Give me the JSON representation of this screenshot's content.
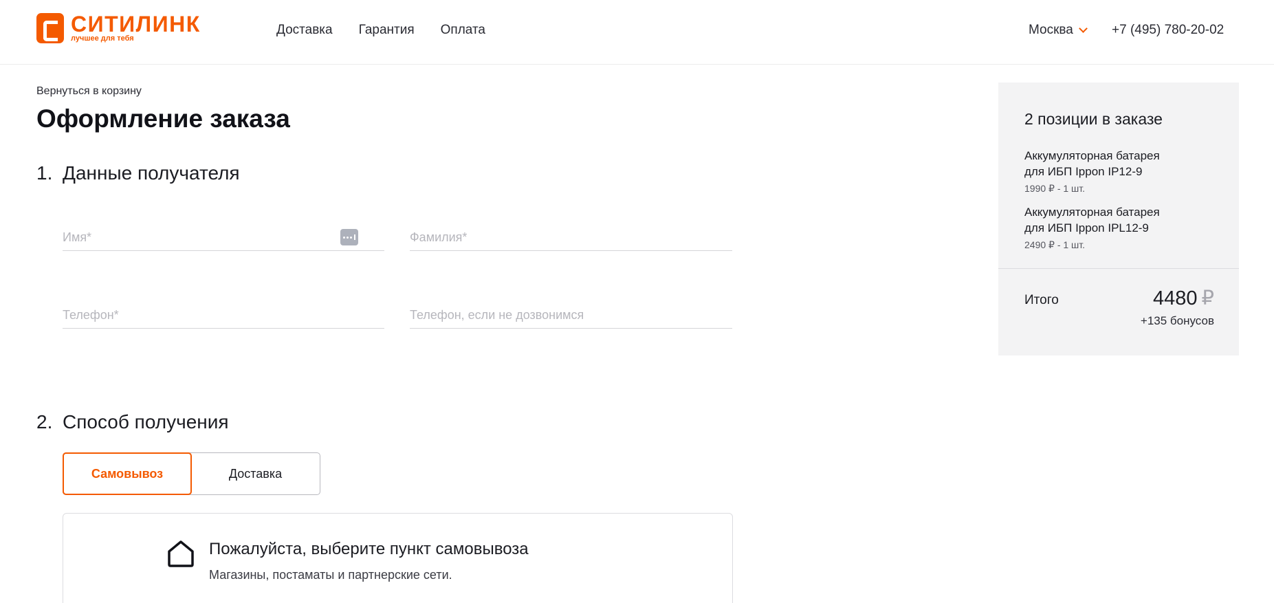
{
  "header": {
    "logo_name": "СИТИЛИНК",
    "logo_tagline": "лучшее для тебя",
    "nav": [
      "Доставка",
      "Гарантия",
      "Оплата"
    ],
    "city": "Москва",
    "phone": "+7 (495) 780-20-02"
  },
  "page": {
    "back_link": "Вернуться в корзину",
    "title": "Оформление заказа"
  },
  "recipient": {
    "number": "1.",
    "title": "Данные получателя",
    "name_placeholder": "Имя*",
    "surname_placeholder": "Фамилия*",
    "phone_placeholder": "Телефон*",
    "phone2_placeholder": "Телефон, если не дозвонимся"
  },
  "delivery": {
    "number": "2.",
    "title": "Способ получения",
    "options": [
      "Самовывоз",
      "Доставка"
    ],
    "selected": "Самовывоз",
    "pickup_title": "Пожалуйста, выберите пункт самовывоза",
    "pickup_subtitle": "Магазины, постаматы и партнерские сети."
  },
  "summary": {
    "title": "2 позиции в заказе",
    "items": [
      {
        "name_line1": "Аккумуляторная батарея",
        "name_line2": "для ИБП Ippon IP12-9",
        "meta": "1990 ₽ - 1 шт."
      },
      {
        "name_line1": "Аккумуляторная батарея",
        "name_line2": "для ИБП Ippon IPL12-9",
        "meta": "2490 ₽ - 1 шт."
      }
    ],
    "total_label": "Итого",
    "total_value": "4480",
    "currency": "₽",
    "bonus": "+135 бонусов"
  },
  "colors": {
    "accent": "#f45a00",
    "summary_bg": "#f3f3f4"
  },
  "icons": {
    "pickup": "house-icon",
    "city_dropdown": "chevron-down-icon",
    "autofill": "autofill-key-icon"
  }
}
